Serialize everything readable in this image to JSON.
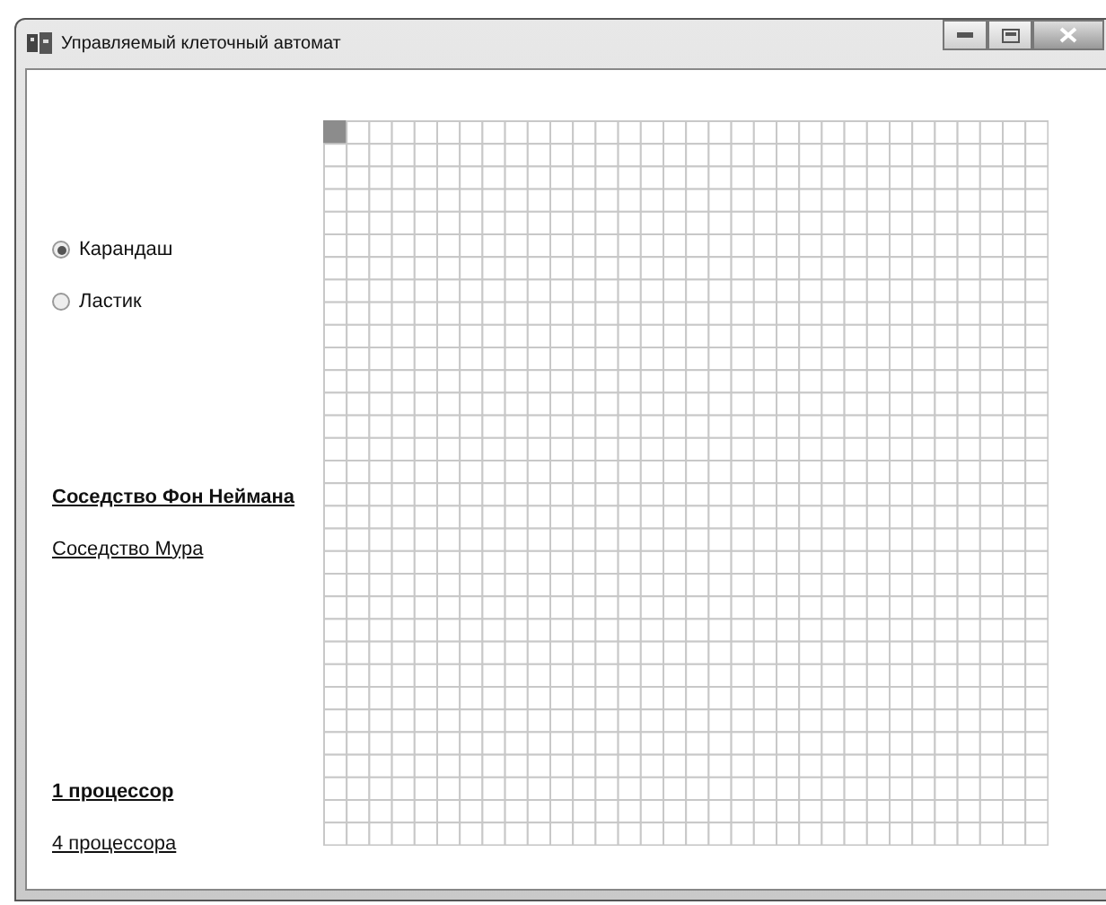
{
  "window": {
    "title": "Управляемый клеточный автомат"
  },
  "tools": [
    {
      "label": "Карандаш",
      "selected": true
    },
    {
      "label": "Ластик",
      "selected": false
    }
  ],
  "neighborhoods": [
    {
      "label": "Соседство Фон Неймана",
      "selected": true
    },
    {
      "label": "Соседство Мура",
      "selected": false
    }
  ],
  "processors": [
    {
      "label": "1 процессор",
      "selected": true
    },
    {
      "label": "4 процессора",
      "selected": false
    }
  ],
  "grid": {
    "rows": [
      [
        true,
        false,
        false,
        false,
        false,
        false,
        false,
        false,
        false,
        false,
        false,
        false,
        false,
        false,
        false,
        false,
        false,
        false,
        false,
        false,
        false,
        false,
        false,
        false,
        false,
        false,
        false,
        false,
        false,
        false,
        false,
        false
      ],
      [
        false,
        false,
        false,
        false,
        false,
        false,
        false,
        false,
        false,
        false,
        false,
        false,
        false,
        false,
        false,
        false,
        false,
        false,
        false,
        false,
        false,
        false,
        false,
        false,
        false,
        false,
        false,
        false,
        false,
        false,
        false,
        false
      ],
      [
        false,
        false,
        false,
        false,
        false,
        false,
        false,
        false,
        false,
        false,
        false,
        false,
        false,
        false,
        false,
        false,
        false,
        false,
        false,
        false,
        false,
        false,
        false,
        false,
        false,
        false,
        false,
        false,
        false,
        false,
        false,
        false
      ],
      [
        false,
        false,
        false,
        false,
        false,
        false,
        false,
        false,
        false,
        false,
        false,
        false,
        false,
        false,
        false,
        false,
        false,
        false,
        false,
        false,
        false,
        false,
        false,
        false,
        false,
        false,
        false,
        false,
        false,
        false,
        false,
        false
      ],
      [
        false,
        false,
        false,
        false,
        false,
        false,
        false,
        false,
        false,
        false,
        false,
        false,
        false,
        false,
        false,
        false,
        false,
        false,
        false,
        false,
        false,
        false,
        false,
        false,
        false,
        false,
        false,
        false,
        false,
        false,
        false,
        false
      ],
      [
        false,
        false,
        false,
        false,
        false,
        false,
        false,
        false,
        false,
        false,
        false,
        false,
        false,
        false,
        false,
        false,
        false,
        false,
        false,
        false,
        false,
        false,
        false,
        false,
        false,
        false,
        false,
        false,
        false,
        false,
        false,
        false
      ],
      [
        false,
        false,
        false,
        false,
        false,
        false,
        false,
        false,
        false,
        false,
        false,
        false,
        false,
        false,
        false,
        false,
        false,
        false,
        false,
        false,
        false,
        false,
        false,
        false,
        false,
        false,
        false,
        false,
        false,
        false,
        false,
        false
      ],
      [
        false,
        false,
        false,
        false,
        false,
        false,
        false,
        false,
        false,
        false,
        false,
        false,
        false,
        false,
        false,
        false,
        false,
        false,
        false,
        false,
        false,
        false,
        false,
        false,
        false,
        false,
        false,
        false,
        false,
        false,
        false,
        false
      ],
      [
        false,
        false,
        false,
        false,
        false,
        false,
        false,
        false,
        false,
        false,
        false,
        false,
        false,
        false,
        false,
        false,
        false,
        false,
        false,
        false,
        false,
        false,
        false,
        false,
        false,
        false,
        false,
        false,
        false,
        false,
        false,
        false
      ],
      [
        false,
        false,
        false,
        false,
        false,
        false,
        false,
        false,
        false,
        false,
        false,
        false,
        false,
        false,
        false,
        false,
        false,
        false,
        false,
        false,
        false,
        false,
        false,
        false,
        false,
        false,
        false,
        false,
        false,
        false,
        false,
        false
      ],
      [
        false,
        false,
        false,
        false,
        false,
        false,
        false,
        false,
        false,
        false,
        false,
        false,
        false,
        false,
        false,
        false,
        false,
        false,
        false,
        false,
        false,
        false,
        false,
        false,
        false,
        false,
        false,
        false,
        false,
        false,
        false,
        false
      ],
      [
        false,
        false,
        false,
        false,
        false,
        false,
        false,
        false,
        false,
        false,
        false,
        false,
        false,
        false,
        false,
        false,
        false,
        false,
        false,
        false,
        false,
        false,
        false,
        false,
        false,
        false,
        false,
        false,
        false,
        false,
        false,
        false
      ],
      [
        false,
        false,
        false,
        false,
        false,
        false,
        false,
        false,
        false,
        false,
        false,
        false,
        false,
        false,
        false,
        false,
        false,
        false,
        false,
        false,
        false,
        false,
        false,
        false,
        false,
        false,
        false,
        false,
        false,
        false,
        false,
        false
      ],
      [
        false,
        false,
        false,
        false,
        false,
        false,
        false,
        false,
        false,
        false,
        false,
        false,
        false,
        false,
        false,
        false,
        false,
        false,
        false,
        false,
        false,
        false,
        false,
        false,
        false,
        false,
        false,
        false,
        false,
        false,
        false,
        false
      ],
      [
        false,
        false,
        false,
        false,
        false,
        false,
        false,
        false,
        false,
        false,
        false,
        false,
        false,
        false,
        false,
        false,
        false,
        false,
        false,
        false,
        false,
        false,
        false,
        false,
        false,
        false,
        false,
        false,
        false,
        false,
        false,
        false
      ],
      [
        false,
        false,
        false,
        false,
        false,
        false,
        false,
        false,
        false,
        false,
        false,
        false,
        false,
        false,
        false,
        false,
        false,
        false,
        false,
        false,
        false,
        false,
        false,
        false,
        false,
        false,
        false,
        false,
        false,
        false,
        false,
        false
      ],
      [
        false,
        false,
        false,
        false,
        false,
        false,
        false,
        false,
        false,
        false,
        false,
        false,
        false,
        false,
        false,
        false,
        false,
        false,
        false,
        false,
        false,
        false,
        false,
        false,
        false,
        false,
        false,
        false,
        false,
        false,
        false,
        false
      ],
      [
        false,
        false,
        false,
        false,
        false,
        false,
        false,
        false,
        false,
        false,
        false,
        false,
        false,
        false,
        false,
        false,
        false,
        false,
        false,
        false,
        false,
        false,
        false,
        false,
        false,
        false,
        false,
        false,
        false,
        false,
        false,
        false
      ],
      [
        false,
        false,
        false,
        false,
        false,
        false,
        false,
        false,
        false,
        false,
        false,
        false,
        false,
        false,
        false,
        false,
        false,
        false,
        false,
        false,
        false,
        false,
        false,
        false,
        false,
        false,
        false,
        false,
        false,
        false,
        false,
        false
      ],
      [
        false,
        false,
        false,
        false,
        false,
        false,
        false,
        false,
        false,
        false,
        false,
        false,
        false,
        false,
        false,
        false,
        false,
        false,
        false,
        false,
        false,
        false,
        false,
        false,
        false,
        false,
        false,
        false,
        false,
        false,
        false,
        false
      ],
      [
        false,
        false,
        false,
        false,
        false,
        false,
        false,
        false,
        false,
        false,
        false,
        false,
        false,
        false,
        false,
        false,
        false,
        false,
        false,
        false,
        false,
        false,
        false,
        false,
        false,
        false,
        false,
        false,
        false,
        false,
        false,
        false
      ],
      [
        false,
        false,
        false,
        false,
        false,
        false,
        false,
        false,
        false,
        false,
        false,
        false,
        false,
        false,
        false,
        false,
        false,
        false,
        false,
        false,
        false,
        false,
        false,
        false,
        false,
        false,
        false,
        false,
        false,
        false,
        false,
        false
      ],
      [
        false,
        false,
        false,
        false,
        false,
        false,
        false,
        false,
        false,
        false,
        false,
        false,
        false,
        false,
        false,
        false,
        false,
        false,
        false,
        false,
        false,
        false,
        false,
        false,
        false,
        false,
        false,
        false,
        false,
        false,
        false,
        false
      ],
      [
        false,
        false,
        false,
        false,
        false,
        false,
        false,
        false,
        false,
        false,
        false,
        false,
        false,
        false,
        false,
        false,
        false,
        false,
        false,
        false,
        false,
        false,
        false,
        false,
        false,
        false,
        false,
        false,
        false,
        false,
        false,
        false
      ],
      [
        false,
        false,
        false,
        false,
        false,
        false,
        false,
        false,
        false,
        false,
        false,
        false,
        false,
        false,
        false,
        false,
        false,
        false,
        false,
        false,
        false,
        false,
        false,
        false,
        false,
        false,
        false,
        false,
        false,
        false,
        false,
        false
      ],
      [
        false,
        false,
        false,
        false,
        false,
        false,
        false,
        false,
        false,
        false,
        false,
        false,
        false,
        false,
        false,
        false,
        false,
        false,
        false,
        false,
        false,
        false,
        false,
        false,
        false,
        false,
        false,
        false,
        false,
        false,
        false,
        false
      ],
      [
        false,
        false,
        false,
        false,
        false,
        false,
        false,
        false,
        false,
        false,
        false,
        false,
        false,
        false,
        false,
        false,
        false,
        false,
        false,
        false,
        false,
        false,
        false,
        false,
        false,
        false,
        false,
        false,
        false,
        false,
        false,
        false
      ],
      [
        false,
        false,
        false,
        false,
        false,
        false,
        false,
        false,
        false,
        false,
        false,
        false,
        false,
        false,
        false,
        false,
        false,
        false,
        false,
        false,
        false,
        false,
        false,
        false,
        false,
        false,
        false,
        false,
        false,
        false,
        false,
        false
      ],
      [
        false,
        false,
        false,
        false,
        false,
        false,
        false,
        false,
        false,
        false,
        false,
        false,
        false,
        false,
        false,
        false,
        false,
        false,
        false,
        false,
        false,
        false,
        false,
        false,
        false,
        false,
        false,
        false,
        false,
        false,
        false,
        false
      ],
      [
        false,
        false,
        false,
        false,
        false,
        false,
        false,
        false,
        false,
        false,
        false,
        false,
        false,
        false,
        false,
        false,
        false,
        false,
        false,
        false,
        false,
        false,
        false,
        false,
        false,
        false,
        false,
        false,
        false,
        false,
        false,
        false
      ],
      [
        false,
        false,
        false,
        false,
        false,
        false,
        false,
        false,
        false,
        false,
        false,
        false,
        false,
        false,
        false,
        false,
        false,
        false,
        false,
        false,
        false,
        false,
        false,
        false,
        false,
        false,
        false,
        false,
        false,
        false,
        false,
        false
      ],
      [
        false,
        false,
        false,
        false,
        false,
        false,
        false,
        false,
        false,
        false,
        false,
        false,
        false,
        false,
        false,
        false,
        false,
        false,
        false,
        false,
        false,
        false,
        false,
        false,
        false,
        false,
        false,
        false,
        false,
        false,
        false,
        false
      ]
    ]
  }
}
